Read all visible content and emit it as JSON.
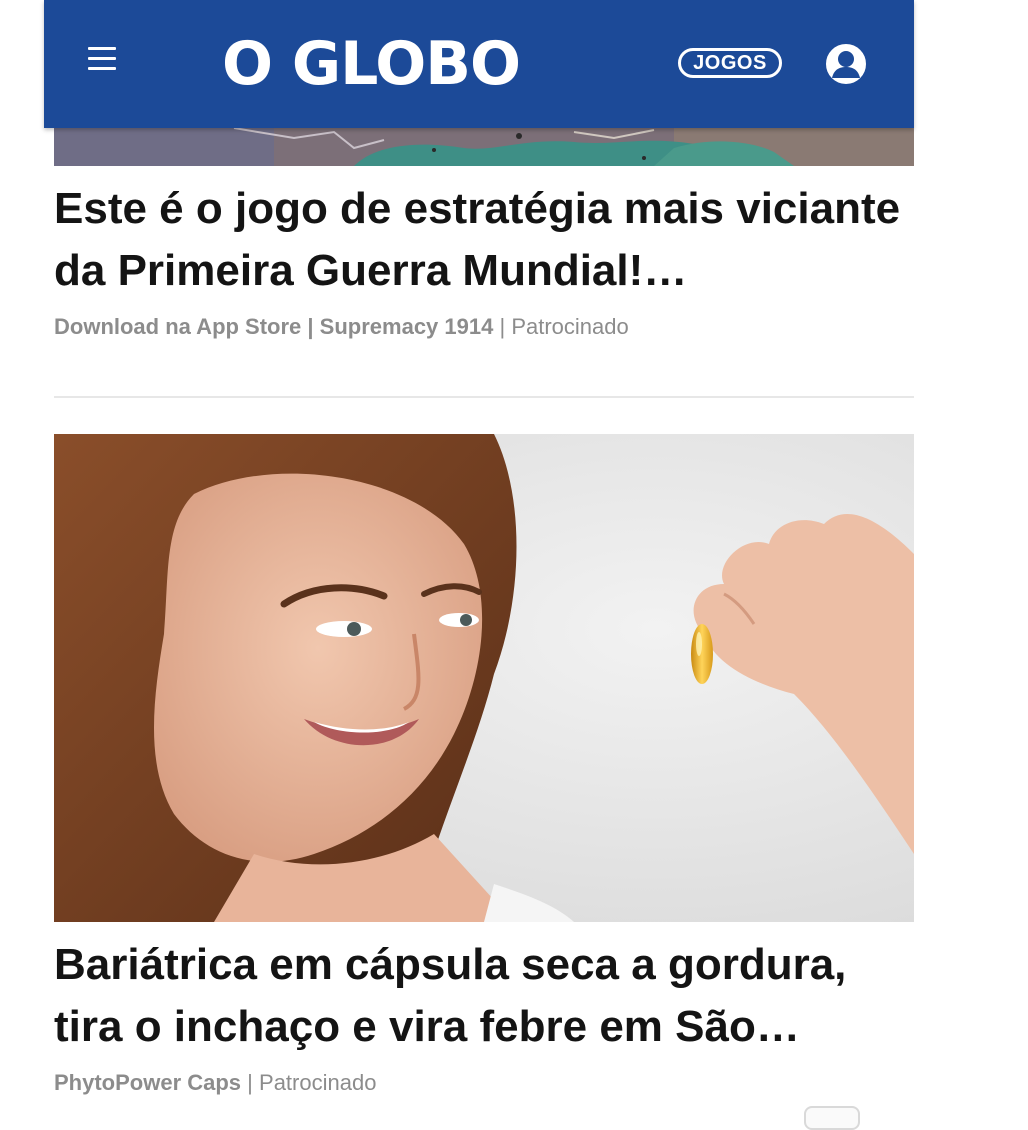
{
  "header": {
    "menu_icon": "hamburger-menu-icon",
    "logo": "O GLOBO",
    "games_label": "JOGOS",
    "user_icon": "user-avatar-icon",
    "background": "#1c4a98"
  },
  "articles": [
    {
      "title": "Este é o jogo de estratégia mais viciante da Primeira Guerra Mundial!…",
      "source": "Download na App Store | Supremacy 1914",
      "separator": "|",
      "label": "Patrocinado"
    },
    {
      "title": "Bariátrica em cápsula seca a gordura, tira o inchaço e vira febre em São…",
      "source": "PhytoPower Caps",
      "separator": "|",
      "label": "Patrocinado"
    }
  ]
}
